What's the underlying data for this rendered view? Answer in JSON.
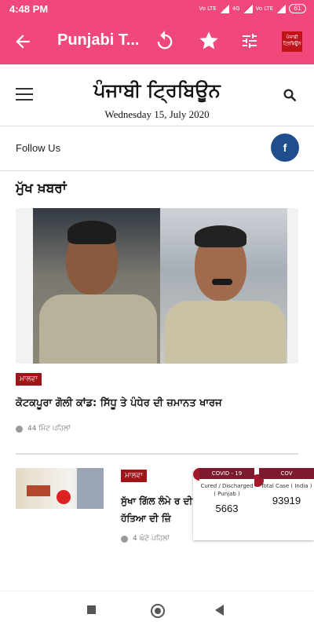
{
  "status": {
    "time": "4:48 PM",
    "battery": "61",
    "net1": "Vo LTE",
    "net2": "4G",
    "net3": "Vo LTE"
  },
  "appbar": {
    "title": "Punjabi T...",
    "logo_text": "ਪੰਜਾਬੀ ਟ੍ਰਿਬਿਊਨ"
  },
  "masthead": {
    "brand": "ਪੰਜਾਬੀ ਟ੍ਰਿਬਿਊਨ",
    "date": "Wednesday 15, July 2020"
  },
  "follow": {
    "label": "Follow Us",
    "facebook": "f"
  },
  "section_title": "ਮੁੱਖ ਖ਼ਬਰਾਂ",
  "top_story": {
    "category": "ਮਾਲਵਾ",
    "headline": "ਕੋਟਕਪੂਰਾ ਗੋਲੀ ਕਾਂਡ: ਸਿੱਧੂ ਤੇ ਪੰਧੇਰ ਦੀ ਜ਼ਮਾਨਤ ਖਾਰਜ",
    "time": "44 ਮਿੰਟ ਪਹਿਲਾਂ"
  },
  "second_story": {
    "category": "ਮਾਲਵਾ",
    "headline": "ਸੁੱਖਾ ਗਿੱਲ ਲੰਮੇ ਰ ਦੀ ਹੱਤਿਆ ਦੀ ਜ਼ਿੰ",
    "time": "4 ਘੰਟੇ ਪਹਿਲਾਂ"
  },
  "covid_widget": {
    "header_left": "COVID - 19",
    "header_right": "COV",
    "left_label": "Cured / Discharged ( Punjab )",
    "left_value": "5663",
    "right_label": "Total Case ( India )",
    "right_value": "93919"
  },
  "colors": {
    "appbar": "#f0487a",
    "badge": "#a01318",
    "facebook": "#1f4e8e"
  }
}
